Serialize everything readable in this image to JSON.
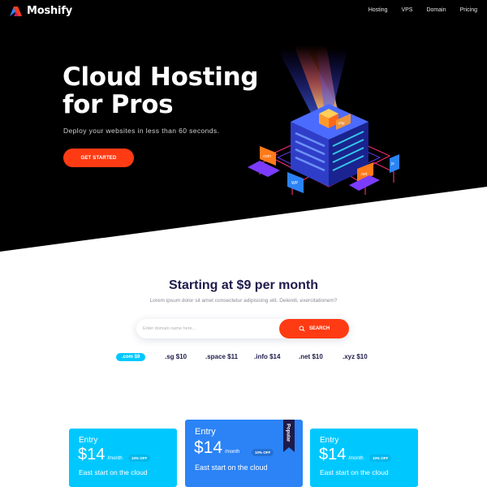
{
  "brand": {
    "name": "Moshify"
  },
  "nav": {
    "items": [
      "Hosting",
      "VPS",
      "Domain",
      "Pricing"
    ]
  },
  "hero": {
    "title_line1": "Cloud Hosting",
    "title_line2": "for Pros",
    "subtitle": "Deploy your websites in less than 60 seconds.",
    "cta_label": "GET STARTED",
    "illustration_labels": [
      ".com",
      "WP",
      ".net",
      "php",
      "js"
    ]
  },
  "pricing_search": {
    "headline": "Starting at $9 per month",
    "subline": "Lorem ipsum dolor sit amet consectetur adipisicing elit. Deleniti, exercitationem?",
    "placeholder": "Enter domain name here...",
    "button_label": "SEARCH"
  },
  "tlds": [
    {
      "label": ".com $9",
      "active": true
    },
    {
      "label": ".sg $10",
      "active": false
    },
    {
      "label": ".space $11",
      "active": false
    },
    {
      "label": ".info $14",
      "active": false
    },
    {
      "label": ".net $10",
      "active": false
    },
    {
      "label": ".xyz $10",
      "active": false
    }
  ],
  "plans": [
    {
      "name": "Entry",
      "price": "$14",
      "period": "/month",
      "badge": "10% OFF",
      "desc": "East start on the cloud"
    },
    {
      "name": "Entry",
      "price": "$14",
      "period": "/month",
      "badge": "10% OFF",
      "desc": "East start on the cloud",
      "ribbon": "Popular"
    },
    {
      "name": "Entry",
      "price": "$14",
      "period": "/month",
      "badge": "10% OFF",
      "desc": "East start on the cloud"
    }
  ],
  "colors": {
    "hero_bg": "#000000",
    "accent": "#ff3b13",
    "cyan": "#00c8ff",
    "blue": "#2b83f6",
    "navy": "#1e1b4b"
  },
  "icons": [
    "moshify-logo-icon",
    "search-icon",
    "popular-ribbon-icon"
  ]
}
